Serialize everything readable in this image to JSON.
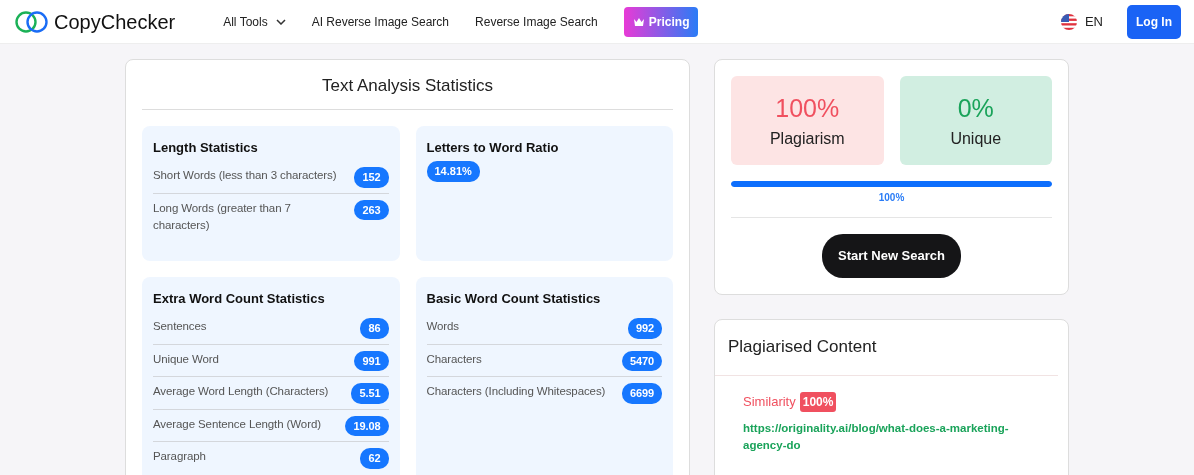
{
  "brand": {
    "name": "CopyChecker"
  },
  "nav": [
    {
      "label": "All Tools",
      "kind": "dropdown"
    },
    {
      "label": "AI Reverse Image Search",
      "kind": "link"
    },
    {
      "label": "Reverse Image Search",
      "kind": "link"
    },
    {
      "label": "Pricing",
      "kind": "premium"
    }
  ],
  "language": "EN",
  "login": "Log In",
  "analysis": {
    "title": "Text Analysis Statistics",
    "groups": [
      {
        "title": "Length Statistics",
        "items": [
          {
            "label": "Short Words (less than 3 characters)",
            "value": "152"
          },
          {
            "label": "Long Words (greater than 7 characters)",
            "value": "263"
          }
        ]
      },
      {
        "title": "Letters to Word Ratio",
        "items": [
          {
            "value": "14.81%"
          }
        ]
      },
      {
        "title": "Extra Word Count Statistics",
        "items": [
          {
            "label": "Sentences",
            "value": "86"
          },
          {
            "label": "Unique Word",
            "value": "991"
          },
          {
            "label": "Average Word Length (Characters)",
            "value": "5.51"
          },
          {
            "label": "Average Sentence Length (Word)",
            "value": "19.08"
          },
          {
            "label": "Paragraph",
            "value": "62"
          }
        ]
      },
      {
        "title": "Basic Word Count Statistics",
        "items": [
          {
            "label": "Words",
            "value": "992"
          },
          {
            "label": "Characters",
            "value": "5470"
          },
          {
            "label": "Characters (Including Whitespaces)",
            "value": "6699"
          }
        ]
      }
    ]
  },
  "summary": [
    {
      "value": "100%",
      "label": "Plagiarism",
      "kind": "plagiarism"
    },
    {
      "value": "0%",
      "label": "Unique",
      "kind": "unique"
    }
  ],
  "progress": {
    "level": 1,
    "reading": "100%"
  },
  "new_search": "Start New Search",
  "content": {
    "title": "Plagiarised Content",
    "matches": [
      {
        "label": "Similarity",
        "score": "100%",
        "url": "https://originality.ai/blog/what-does-a-marketing-agency-do"
      }
    ]
  }
}
